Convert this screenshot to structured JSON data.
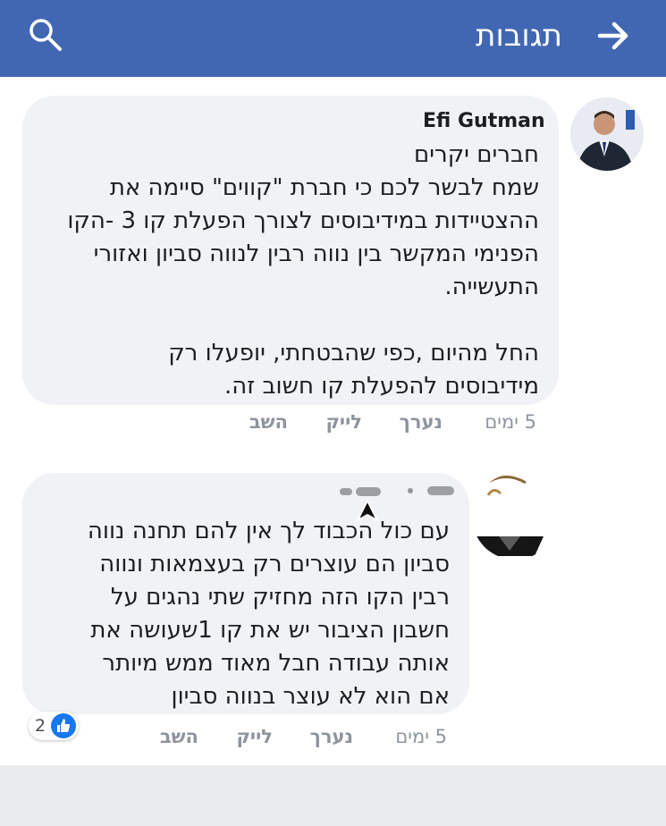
{
  "header": {
    "title": "תגובות",
    "back_icon": "arrow-right-icon",
    "search_icon": "search-icon",
    "bg_color": "#4267b2"
  },
  "comments": [
    {
      "author": "Efi Gutman",
      "text": "חברים יקרים\nשמח לבשר לכם כי חברת \"קווים\" סיימה את\nההצטיידות במידיבוסים לצורך הפעלת קו 3 -הקו\nהפנימי המקשר בין נווה רבין לנווה סביון ואזורי\nהתעשייה.\n\nהחל מהיום ,כפי שהבטחתי, יופעלו רק\nמידיבוסים להפעלת קו חשוב זה.",
      "time": "5 ימים",
      "reply": "נערך",
      "like": "לייק",
      "answer": "השב"
    },
    {
      "author": "",
      "text": "עם כול הכבוד לך אין להם תחנה נווה\nסביון הם  עוצרים רק בעצמאות ונווה\nרבין הקו הזה מחזיק שתי נהגים על\nחשבון הציבור יש את קו 1שעושה את\nאותה עבודה חבל מאוד ממש מיותר\nאם הוא לא עוצר בנווה סביון",
      "time": "5 ימים",
      "reply": "נערך",
      "like": "לייק",
      "answer": "השב",
      "reaction_count": "2",
      "reaction_icon": "thumbs-up-icon"
    }
  ]
}
